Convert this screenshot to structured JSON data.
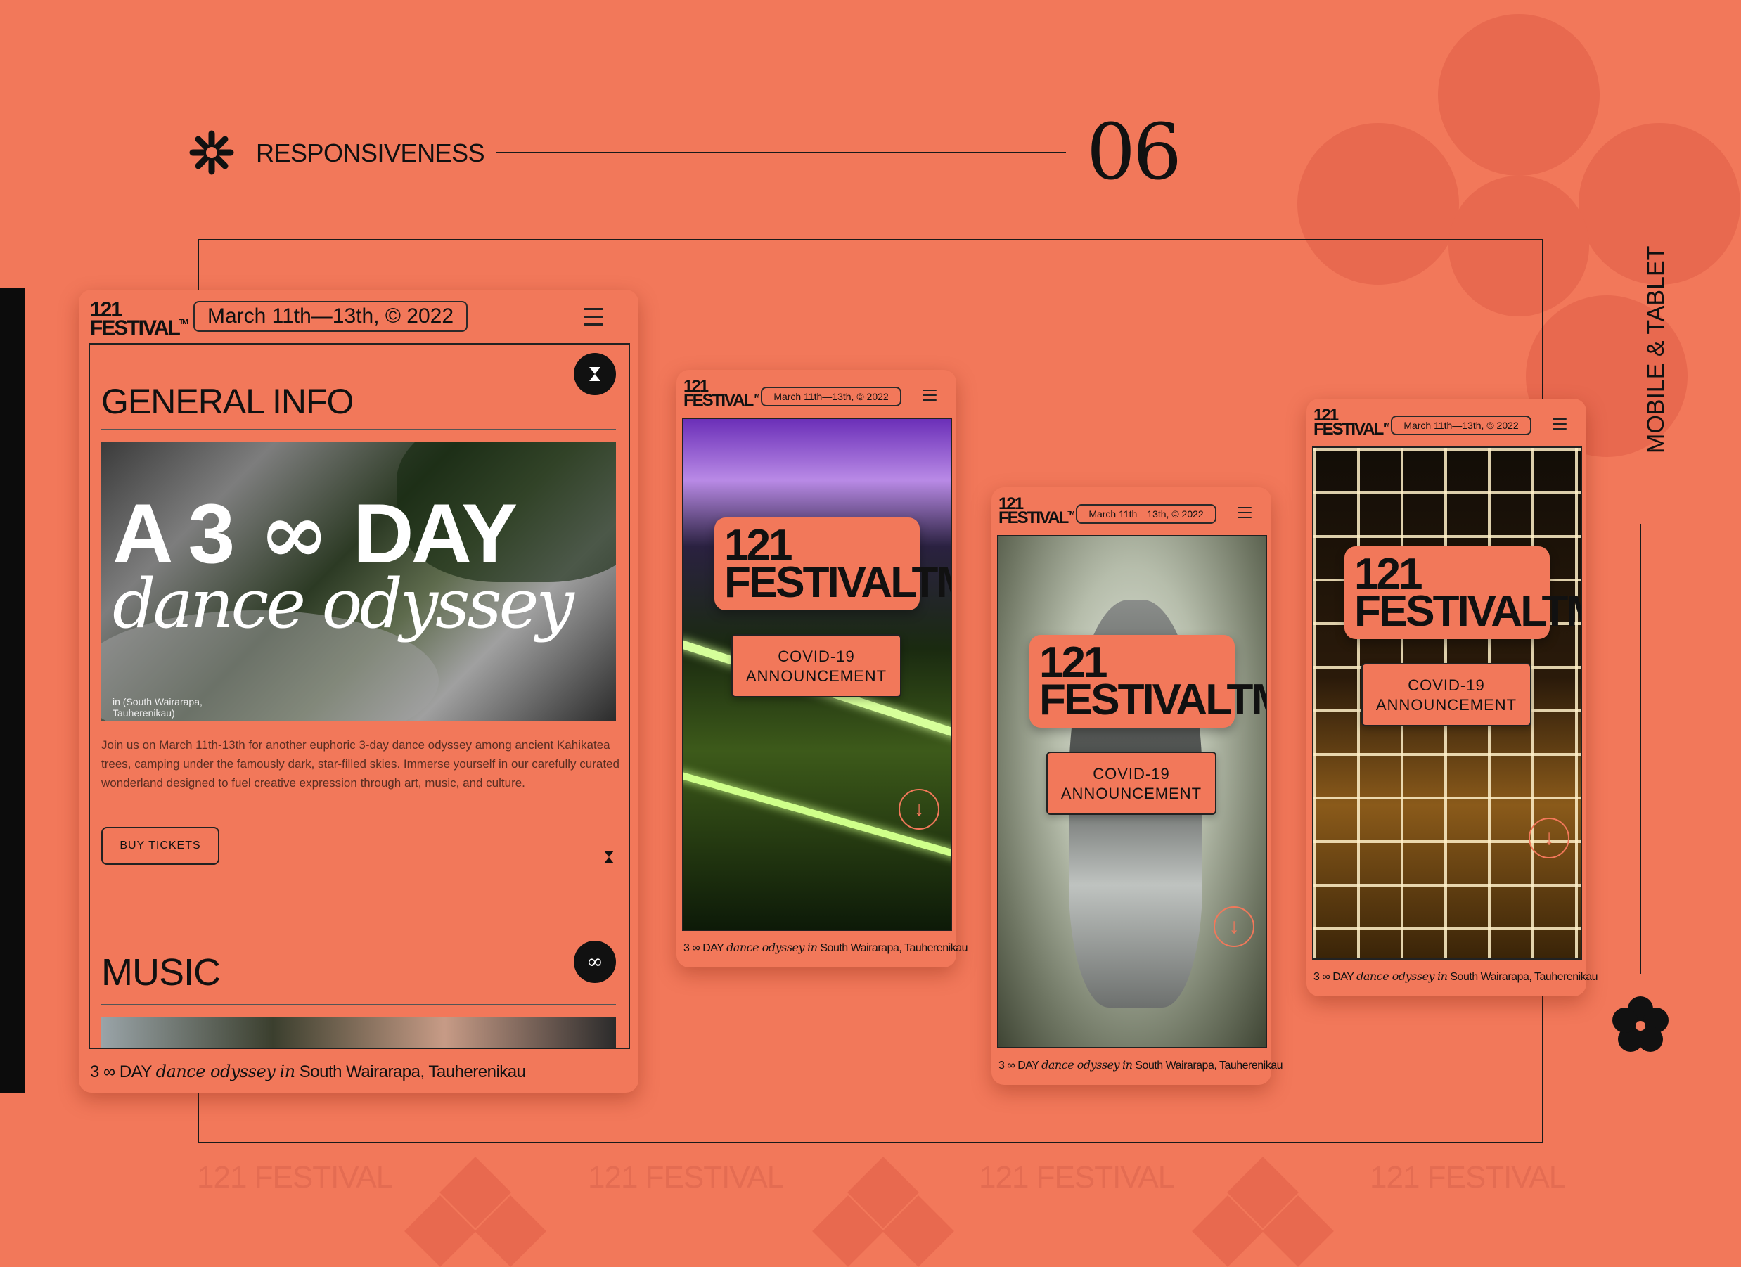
{
  "colors": {
    "background": "#f2785a",
    "ink": "#111111",
    "accent_dark": "#e8694f"
  },
  "header": {
    "section_label": "RESPONSIVENESS",
    "section_number": "06",
    "icon": "asterisk-icon"
  },
  "side": {
    "label": "MOBILE & TABLET",
    "icon": "flower-icon"
  },
  "watermarks": [
    "121 FESTIVAL",
    "121 FESTIVAL",
    "121 FESTIVAL",
    "121 FESTIVAL"
  ],
  "brand": {
    "logo_top": "121",
    "logo_bottom": "FESTIVAL",
    "tm": "TM"
  },
  "date_label": "March 11th—13th, © 2022",
  "footer": {
    "lead": "3",
    "day": "DAY",
    "italic1": "dance odyssey",
    "italic2": "in",
    "location": "South Wairarapa, Tauherenikau"
  },
  "tablet": {
    "general_info_heading": "GENERAL INFO",
    "hero_line1_a": "A 3",
    "hero_line1_b": "DAY",
    "hero_line2": "dance odyssey",
    "hero_caption": "in (South Wairarapa, Tauherenikau)",
    "body_text": "Join us on March 11th-13th for another euphoric 3-day dance odyssey among ancient Kahikatea trees, camping under the famously dark, star-filled skies. Immerse yourself in our carefully curated wonderland designed to fuel creative expression through art, music, and culture.",
    "buy_tickets": "BUY TICKETS",
    "music_heading": "MUSIC"
  },
  "mobile": {
    "covid_line1": "COVID-19",
    "covid_line2": "ANNOUNCEMENT"
  }
}
